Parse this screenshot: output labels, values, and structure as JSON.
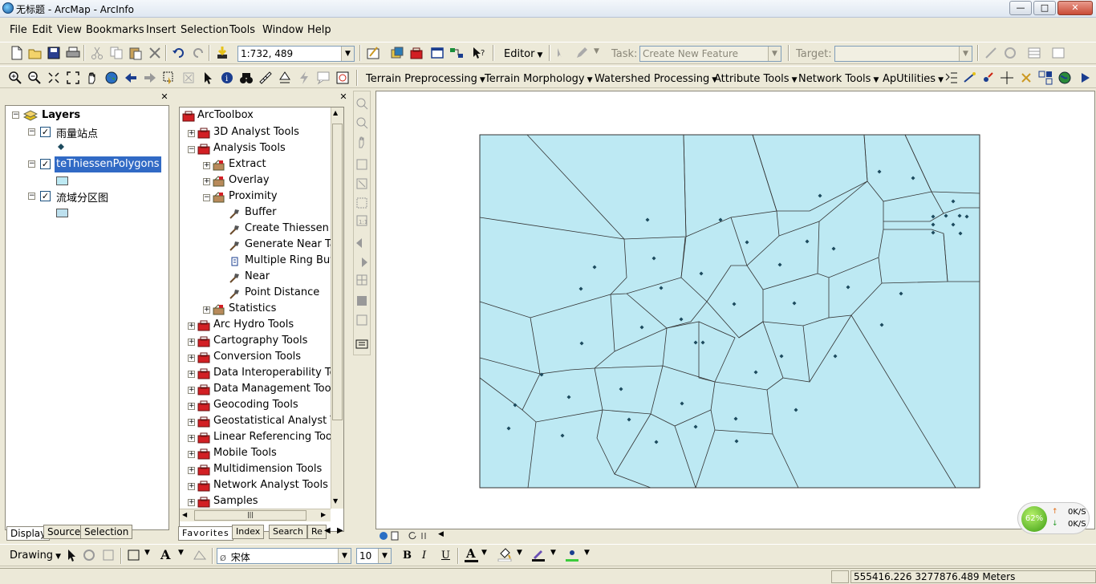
{
  "window": {
    "title": "无标题 - ArcMap - ArcInfo",
    "minimize": "—",
    "maximize": "□",
    "close": "✕"
  },
  "menu": [
    "File",
    "Edit",
    "View",
    "Bookmarks",
    "Insert",
    "Selection",
    "Tools",
    "Window",
    "Help"
  ],
  "standard_toolbar": {
    "scale_value": "1:732, 489",
    "editor_label": "Editor",
    "task_label": "Task:",
    "task_value": "Create New Feature",
    "target_label": "Target:",
    "target_value": ""
  },
  "tools_toolbar": {
    "menus": [
      "Terrain Preprocessing",
      "Terrain Morphology",
      "Watershed Processing",
      "Attribute Tools",
      "Network Tools",
      "ApUtilities"
    ]
  },
  "toc": {
    "root": "Layers",
    "layers": [
      {
        "name": "雨量站点",
        "checked": true,
        "symbol": "point"
      },
      {
        "name": "teThiessenPolygons",
        "checked": true,
        "symbol": "polygon",
        "selected": true
      },
      {
        "name": "流域分区图",
        "checked": true,
        "symbol": "polygon"
      }
    ],
    "tabs": [
      "Display",
      "Source",
      "Selection"
    ],
    "active_tab": "Display"
  },
  "toolbox": {
    "root": "ArcToolbox",
    "items": [
      {
        "label": "3D Analyst Tools",
        "level": 0,
        "expander": "+",
        "kind": "toolbox"
      },
      {
        "label": "Analysis Tools",
        "level": 0,
        "expander": "-",
        "kind": "toolbox"
      },
      {
        "label": "Extract",
        "level": 1,
        "expander": "+",
        "kind": "toolset"
      },
      {
        "label": "Overlay",
        "level": 1,
        "expander": "+",
        "kind": "toolset"
      },
      {
        "label": "Proximity",
        "level": 1,
        "expander": "-",
        "kind": "toolset"
      },
      {
        "label": "Buffer",
        "level": 2,
        "expander": "",
        "kind": "tool"
      },
      {
        "label": "Create Thiessen Pc",
        "level": 2,
        "expander": "",
        "kind": "tool"
      },
      {
        "label": "Generate Near Tab",
        "level": 2,
        "expander": "",
        "kind": "tool"
      },
      {
        "label": "Multiple Ring Buffe",
        "level": 2,
        "expander": "",
        "kind": "script"
      },
      {
        "label": "Near",
        "level": 2,
        "expander": "",
        "kind": "tool"
      },
      {
        "label": "Point Distance",
        "level": 2,
        "expander": "",
        "kind": "tool"
      },
      {
        "label": "Statistics",
        "level": 1,
        "expander": "+",
        "kind": "toolset"
      },
      {
        "label": "Arc Hydro Tools",
        "level": 0,
        "expander": "+",
        "kind": "toolbox"
      },
      {
        "label": "Cartography Tools",
        "level": 0,
        "expander": "+",
        "kind": "toolbox"
      },
      {
        "label": "Conversion Tools",
        "level": 0,
        "expander": "+",
        "kind": "toolbox"
      },
      {
        "label": "Data Interoperability Too",
        "level": 0,
        "expander": "+",
        "kind": "toolbox"
      },
      {
        "label": "Data Management Tools",
        "level": 0,
        "expander": "+",
        "kind": "toolbox"
      },
      {
        "label": "Geocoding Tools",
        "level": 0,
        "expander": "+",
        "kind": "toolbox"
      },
      {
        "label": "Geostatistical Analyst Toc",
        "level": 0,
        "expander": "+",
        "kind": "toolbox"
      },
      {
        "label": "Linear Referencing Tools",
        "level": 0,
        "expander": "+",
        "kind": "toolbox"
      },
      {
        "label": "Mobile Tools",
        "level": 0,
        "expander": "+",
        "kind": "toolbox"
      },
      {
        "label": "Multidimension Tools",
        "level": 0,
        "expander": "+",
        "kind": "toolbox"
      },
      {
        "label": "Network Analyst Tools",
        "level": 0,
        "expander": "+",
        "kind": "toolbox"
      },
      {
        "label": "Samples",
        "level": 0,
        "expander": "+",
        "kind": "toolbox"
      }
    ],
    "tabs": [
      "Favorites",
      "Index",
      "Search",
      "Re"
    ],
    "active_tab": "Favorites"
  },
  "network_meter": {
    "percent": "62%",
    "up": "0K/S",
    "down": "0K/S"
  },
  "drawing_toolbar": {
    "drawing_label": "Drawing",
    "font_name": "宋体",
    "font_size": "10",
    "bold": "B",
    "italic": "I",
    "underline": "U",
    "text_tool": "A"
  },
  "status": {
    "coords": "555416.226  3277876.489 Meters"
  },
  "colors": {
    "map_fill": "#bde9f3",
    "accent": "#316ac5",
    "point": "#1c4a5e"
  }
}
